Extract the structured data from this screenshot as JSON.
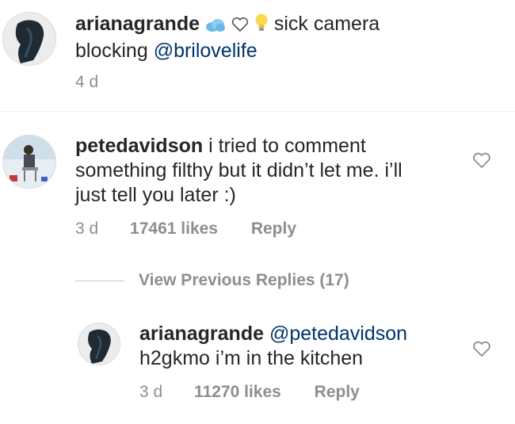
{
  "caption": {
    "username": "arianagrande",
    "emoji": [
      "cloud-emoji",
      "white-heart-emoji",
      "light-bulb-emoji"
    ],
    "text": "sick camera",
    "text_line2": "blocking",
    "mention": "@brilovelife",
    "timestamp": "4 d"
  },
  "comments": [
    {
      "username": "petedavidson",
      "text_line1": "i tried to comment",
      "text_line2": "something filthy but it didn’t let me. i’ll",
      "text_line3": "just tell you later :)",
      "timestamp": "3 d",
      "likes": "17461 likes",
      "reply_label": "Reply",
      "view_replies_label": "View Previous Replies (17)",
      "replies": [
        {
          "username": "arianagrande",
          "mention": "@petedavidson",
          "text": "h2gkmo i’m in the kitchen",
          "timestamp": "3 d",
          "likes": "11270 likes",
          "reply_label": "Reply"
        }
      ]
    }
  ],
  "colors": {
    "text": "#262626",
    "muted": "#8e8e8e",
    "mention": "#003569",
    "divider": "#efefef"
  }
}
